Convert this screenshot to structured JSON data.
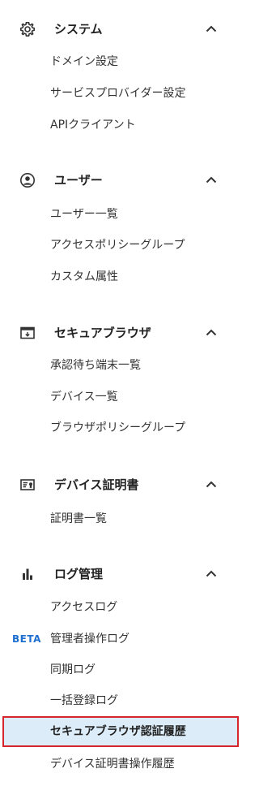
{
  "sections": [
    {
      "title": "システム",
      "icon": "gear-icon",
      "expanded": true,
      "items": [
        "ドメイン設定",
        "サービスプロバイダー設定",
        "APIクライアント"
      ]
    },
    {
      "title": "ユーザー",
      "icon": "user-circle-icon",
      "expanded": true,
      "items": [
        "ユーザー一覧",
        "アクセスポリシーグループ",
        "カスタム属性"
      ]
    },
    {
      "title": "セキュアブラウザ",
      "icon": "browser-window-icon",
      "expanded": true,
      "items": [
        "承認待ち端末一覧",
        "デバイス一覧",
        "ブラウザポリシーグループ"
      ]
    },
    {
      "title": "デバイス証明書",
      "icon": "certificate-icon",
      "expanded": true,
      "items": [
        "証明書一覧"
      ]
    },
    {
      "title": "ログ管理",
      "icon": "bar-chart-icon",
      "expanded": true,
      "items": [
        "アクセスログ",
        "管理者操作ログ",
        "同期ログ",
        "一括登録ログ",
        "セキュアブラウザ認証履歴",
        "デバイス証明書操作履歴"
      ],
      "beta_badge": "BETA",
      "active_item": "セキュアブラウザ認証履歴"
    }
  ],
  "colors": {
    "active_bg": "#dcecf9",
    "active_border": "#d6252d",
    "beta": "#1e6fd0"
  }
}
